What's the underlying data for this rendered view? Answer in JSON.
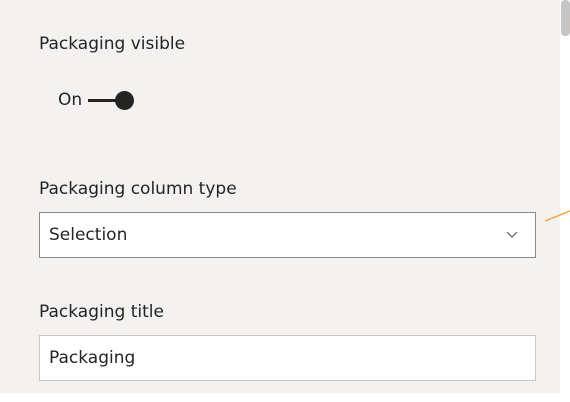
{
  "packaging_visible": {
    "label": "Packaging visible",
    "toggle_label": "On",
    "toggle_state": true
  },
  "packaging_column_type": {
    "label": "Packaging column type",
    "selected_value": "Selection"
  },
  "packaging_title": {
    "label": "Packaging title",
    "value": "Packaging"
  },
  "colors": {
    "panel_bg": "#f3f2f1",
    "text": "#252423",
    "callout_arrow": "#f2a73b"
  },
  "icons": {
    "dropdown": "chevron-down-icon"
  }
}
